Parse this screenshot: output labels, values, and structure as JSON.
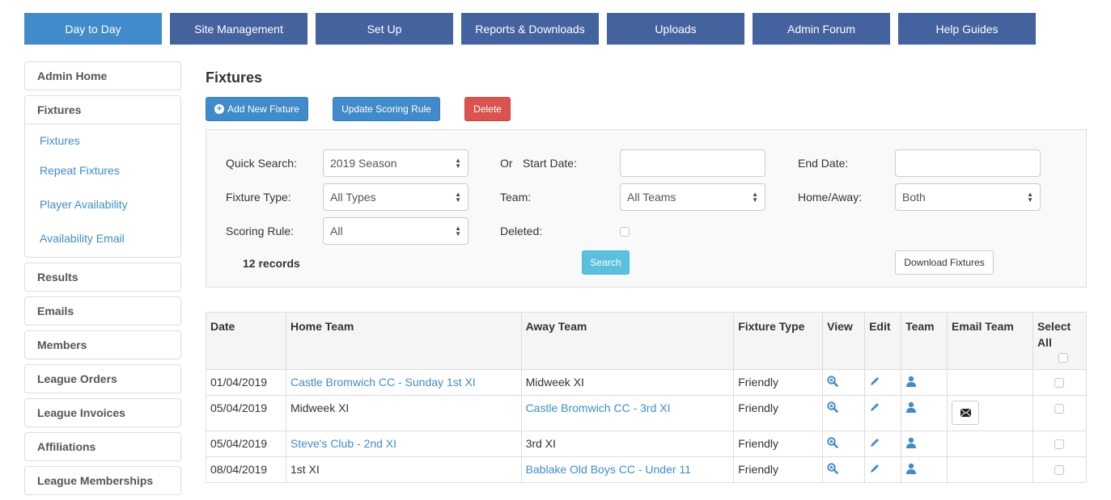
{
  "topnav": {
    "tabs": [
      {
        "label": "Day to Day",
        "active": true
      },
      {
        "label": "Site Management"
      },
      {
        "label": "Set Up"
      },
      {
        "label": "Reports & Downloads"
      },
      {
        "label": "Uploads"
      },
      {
        "label": "Admin Forum"
      },
      {
        "label": "Help Guides"
      }
    ]
  },
  "sidebar": {
    "admin_home": "Admin Home",
    "fixtures_group": {
      "heading": "Fixtures",
      "links": [
        "Fixtures",
        "Repeat Fixtures",
        "Player Availability",
        "Availability Email"
      ]
    },
    "items": [
      "Results",
      "Emails",
      "Members",
      "League Orders",
      "League Invoices",
      "Affiliations",
      "League Memberships"
    ]
  },
  "main": {
    "title": "Fixtures",
    "actions": {
      "add": "Add New Fixture",
      "update_scoring": "Update Scoring Rule",
      "delete": "Delete"
    },
    "search": {
      "quick_search_label": "Quick Search:",
      "quick_search_value": "2019 Season",
      "or_label": "Or",
      "start_date_label": "Start Date:",
      "start_date_value": "",
      "end_date_label": "End Date:",
      "end_date_value": "",
      "fixture_type_label": "Fixture Type:",
      "fixture_type_value": "All Types",
      "team_label": "Team:",
      "team_value": "All Teams",
      "home_away_label": "Home/Away:",
      "home_away_value": "Both",
      "scoring_rule_label": "Scoring Rule:",
      "scoring_rule_value": "All",
      "deleted_label": "Deleted:",
      "deleted_checked": false,
      "records": "12 records",
      "search_button": "Search",
      "download_button": "Download Fixtures"
    },
    "table": {
      "headers": [
        "Date",
        "Home Team",
        "Away Team",
        "Fixture Type",
        "View",
        "Edit",
        "Team",
        "Email Team",
        "Select All"
      ],
      "rows": [
        {
          "date": "01/04/2019",
          "home": "Castle Bromwich CC - Sunday 1st XI",
          "home_link": true,
          "away": "Midweek XI",
          "away_link": false,
          "type": "Friendly",
          "email": false
        },
        {
          "date": "05/04/2019",
          "home": "Midweek XI",
          "home_link": false,
          "away": "Castle Bromwich CC - 3rd XI",
          "away_link": true,
          "type": "Friendly",
          "email": true
        },
        {
          "date": "05/04/2019",
          "home": "Steve's Club - 2nd XI",
          "home_link": true,
          "away": "3rd XI",
          "away_link": false,
          "type": "Friendly",
          "email": false
        },
        {
          "date": "08/04/2019",
          "home": "1st XI",
          "home_link": false,
          "away": "Bablake Old Boys CC - Under 11",
          "away_link": true,
          "type": "Friendly",
          "email": false
        }
      ]
    }
  },
  "colors": {
    "nav": "#44629e",
    "nav_active": "#428bca",
    "link": "#428bca",
    "danger": "#d9534f",
    "info": "#5bc0de"
  }
}
